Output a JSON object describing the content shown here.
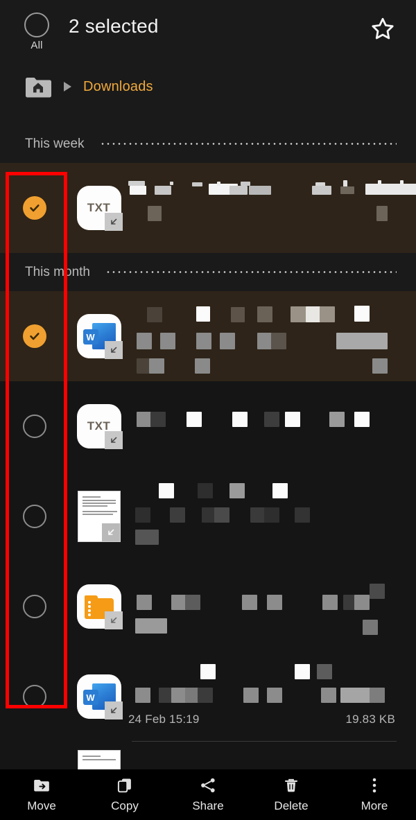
{
  "header": {
    "select_all_label": "All",
    "title": "2 selected",
    "favorite_icon": "star-icon",
    "select_all_icon": "circle-unchecked-icon"
  },
  "breadcrumb": {
    "home_icon": "home-folder-icon",
    "separator_icon": "triangle-right-icon",
    "current": "Downloads",
    "accent_color": "#f0a93c"
  },
  "groups": [
    {
      "label": "This week"
    },
    {
      "label": "This month"
    }
  ],
  "rows": [
    {
      "selected": true,
      "icon": "txt-file-icon",
      "icon_label": "TXT",
      "name_redacted": true,
      "date": "",
      "size": ""
    },
    {
      "selected": true,
      "icon": "word-file-icon",
      "icon_label": "W",
      "name_redacted": true,
      "date": "",
      "size": ""
    },
    {
      "selected": false,
      "icon": "txt-file-icon",
      "icon_label": "TXT",
      "name_redacted": true,
      "date": "",
      "size": ""
    },
    {
      "selected": false,
      "icon": "page-thumbnail-icon",
      "icon_label": "",
      "name_redacted": true,
      "date": "",
      "size": ""
    },
    {
      "selected": false,
      "icon": "folder-archive-icon",
      "icon_label": "",
      "name_redacted": true,
      "date": "",
      "size": ""
    },
    {
      "selected": false,
      "icon": "word-file-icon",
      "icon_label": "W",
      "name_redacted": true,
      "date": "24 Feb 15:19",
      "size": "19.83 KB"
    },
    {
      "selected": false,
      "icon": "page-thumbnail-icon",
      "icon_label": "",
      "name_redacted": true,
      "date": "",
      "size": ""
    }
  ],
  "toolbar": {
    "items": [
      {
        "label": "Move",
        "icon": "move-to-folder-icon"
      },
      {
        "label": "Copy",
        "icon": "copy-icon"
      },
      {
        "label": "Share",
        "icon": "share-icon"
      },
      {
        "label": "Delete",
        "icon": "trash-icon"
      },
      {
        "label": "More",
        "icon": "overflow-menu-icon"
      }
    ]
  },
  "annotation": {
    "color": "#ff0000",
    "target": "selection-checkbox-column"
  },
  "colors": {
    "accent": "#f0a030",
    "selected_row_bg": "#2e2419",
    "row_bg": "#151515",
    "app_bg": "#1a1a1a"
  }
}
